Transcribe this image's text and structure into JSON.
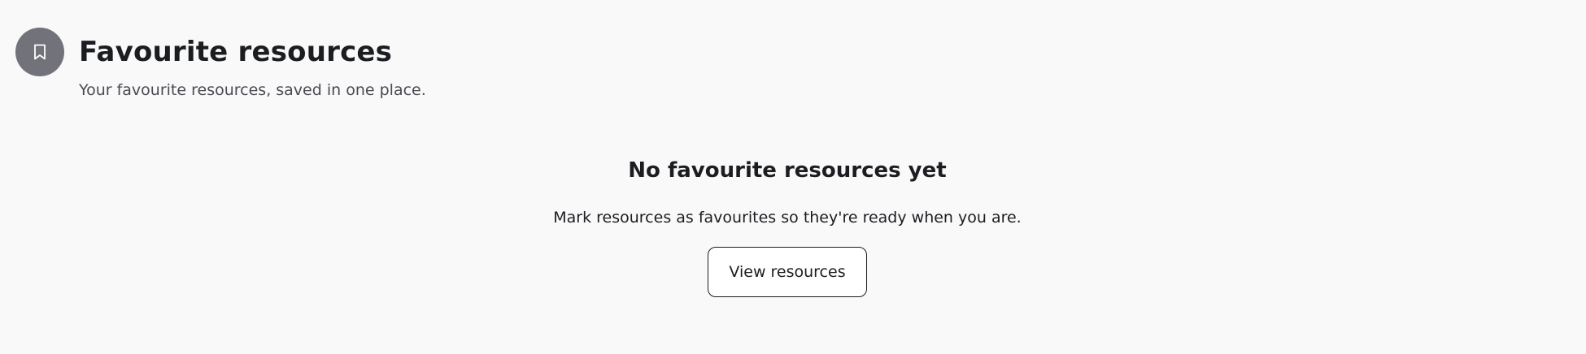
{
  "header": {
    "icon": "bookmark-icon",
    "title": "Favourite resources",
    "subtitle": "Your favourite resources, saved in one place."
  },
  "empty_state": {
    "title": "No favourite resources yet",
    "description": "Mark resources as favourites so they're ready when you are.",
    "button_label": "View resources"
  },
  "colors": {
    "background": "#f9f9f9",
    "icon_circle": "#71727a",
    "text": "#1c1d21",
    "muted_text": "#4a4b52"
  }
}
